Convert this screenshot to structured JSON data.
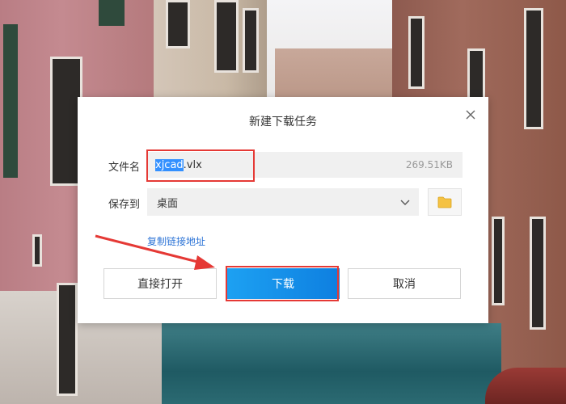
{
  "dialog": {
    "title": "新建下载任务",
    "filename_label": "文件名",
    "filename_selected": "xjcad",
    "filename_rest": ".vlx",
    "file_size": "269.51KB",
    "save_label": "保存到",
    "save_location": "桌面",
    "copy_link": "复制链接地址",
    "buttons": {
      "open_direct": "直接打开",
      "download": "下载",
      "cancel": "取消"
    }
  },
  "colors": {
    "accent": "#1890ff",
    "annotation": "#e53935",
    "link": "#2b73d6",
    "folder": "#f5c242"
  },
  "icons": [
    "close-icon",
    "chevron-down-icon",
    "folder-icon"
  ]
}
